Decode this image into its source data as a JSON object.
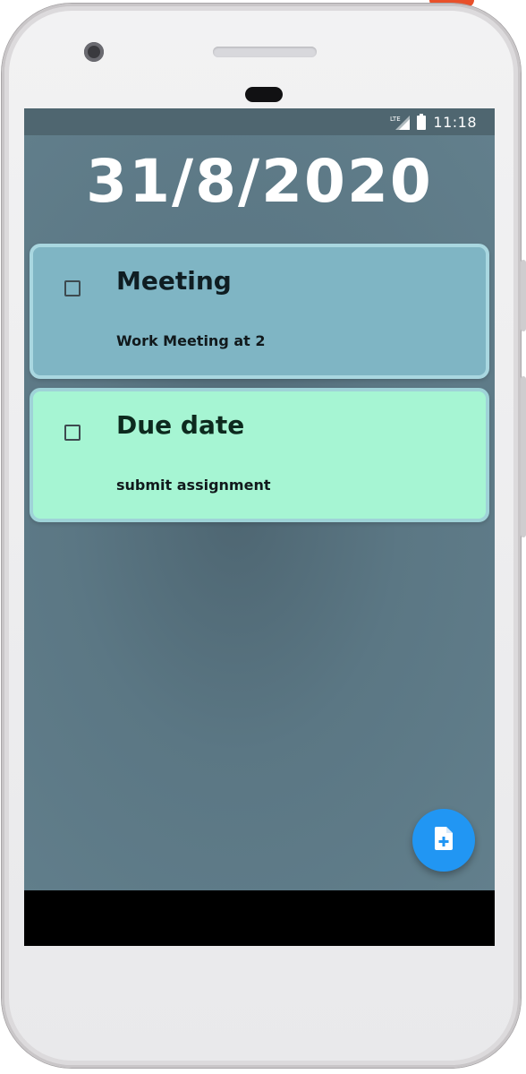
{
  "status_bar": {
    "network_label": "LTE",
    "time": "11:18",
    "background": "#4f6670"
  },
  "header": {
    "date": "31/8/2020"
  },
  "tasks": [
    {
      "title": "Meeting",
      "description": "Work Meeting at 2",
      "checked": false,
      "color": "#7fb5c4"
    },
    {
      "title": "Due date",
      "description": "submit assignment",
      "checked": false,
      "color": "#a6f5d3"
    }
  ],
  "fab": {
    "icon": "note-add-icon",
    "color": "#2196f3"
  },
  "colors": {
    "app_background": "#607d8b",
    "accent": "#2196f3"
  }
}
